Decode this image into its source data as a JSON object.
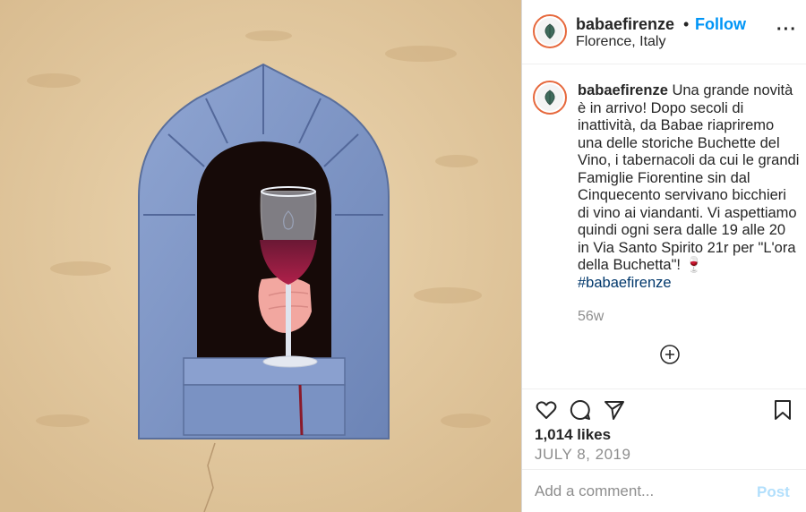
{
  "header": {
    "username": "babaefirenze",
    "separator": "•",
    "follow_label": "Follow",
    "location": "Florence, Italy",
    "more_label": "···"
  },
  "caption": {
    "username": "babaefirenze",
    "text": "Una grande novità è in arrivo! Dopo secoli di inattività, da Babae riapriremo una delle storiche Buchette del Vino, i tabernacoli da cui le grandi Famiglie Fiorentine sin dal Cinquecento servivano bicchieri di vino ai viandanti. Vi aspettiamo quindi ogni sera dalle 19 alle 20 in Via Santo Spirito 21r per \"L'ora della Buchetta\"! 🍷",
    "hashtag": "#babaefirenze",
    "age": "56w"
  },
  "icons": {
    "load_more": "plus-circle-icon",
    "like": "heart-icon",
    "comment": "speech-bubble-icon",
    "share": "paper-plane-icon",
    "save": "bookmark-icon",
    "avatar_logo": "vine-leaf-logo"
  },
  "stats": {
    "likes": "1,014 likes",
    "date": "JULY 8, 2019"
  },
  "add_comment": {
    "placeholder": "Add a comment...",
    "post_label": "Post"
  },
  "colors": {
    "link_blue": "#0095f6",
    "post_disabled": "#b2dffc",
    "hashtag": "#00376b",
    "muted": "#8e8e8e",
    "wall": "#e2c8a0",
    "stone": "#7f97c7"
  }
}
